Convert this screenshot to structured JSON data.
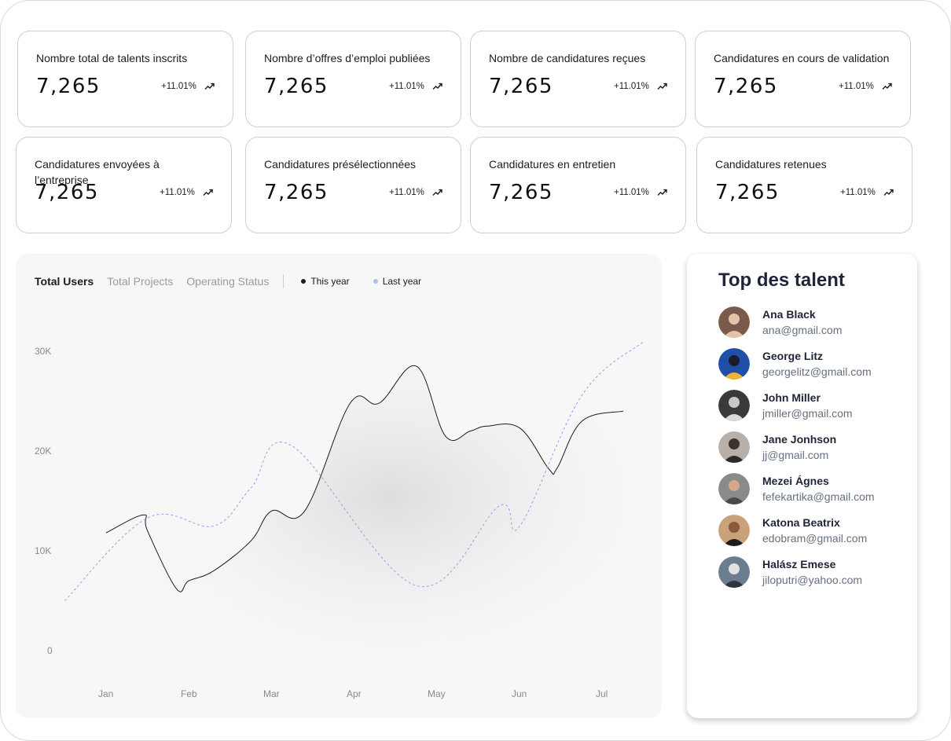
{
  "stats": [
    {
      "label": "Nombre total de talents inscrits",
      "value": "7,265",
      "change": "+11.01%"
    },
    {
      "label": "Nombre d’offres d’emploi publiées",
      "value": "7,265",
      "change": "+11.01%"
    },
    {
      "label": "Nombre de candidatures reçues",
      "value": "7,265",
      "change": "+11.01%"
    },
    {
      "label": "Candidatures en cours de validation",
      "value": "7,265",
      "change": "+11.01%"
    },
    {
      "label": "Candidatures envoyées à l’entreprise",
      "value": "7,265",
      "change": "+11.01%"
    },
    {
      "label": "Candidatures présélectionnées",
      "value": "7,265",
      "change": "+11.01%"
    },
    {
      "label": "Candidatures en entretien",
      "value": "7,265",
      "change": "+11.01%"
    },
    {
      "label": "Candidatures retenues",
      "value": "7,265",
      "change": "+11.01%"
    }
  ],
  "chart_tabs": [
    {
      "label": "Total Users",
      "active": true
    },
    {
      "label": "Total Projects",
      "active": false
    },
    {
      "label": "Operating Status",
      "active": false
    }
  ],
  "chart_data": {
    "type": "line",
    "categories": [
      "Jan",
      "Feb",
      "Mar",
      "Apr",
      "May",
      "Jun",
      "Jul"
    ],
    "y_ticks": [
      "0",
      "10K",
      "20K",
      "30K"
    ],
    "ylim": [
      0,
      30000
    ],
    "grid": false,
    "legend_position": "top",
    "series": [
      {
        "name": "This year",
        "color": "#1c1c1c",
        "style": "solid",
        "area_fill": true,
        "x": [
          0.0,
          0.45,
          0.5,
          0.85,
          1.0,
          1.3,
          1.75,
          2.0,
          2.4,
          2.95,
          3.3,
          3.75,
          4.1,
          4.4,
          4.6,
          5.0,
          5.35,
          5.45,
          5.75,
          6.25
        ],
        "y": [
          11800,
          13600,
          12000,
          6200,
          7000,
          8000,
          11000,
          14000,
          14000,
          24800,
          24800,
          28500,
          21500,
          22000,
          22500,
          22300,
          18200,
          18300,
          23000,
          24000
        ]
      },
      {
        "name": "Last year",
        "color": "#8fa3ec",
        "style": "dashed",
        "area_fill": false,
        "x": [
          -0.5,
          0.5,
          1.3,
          1.75,
          2.25,
          3.75,
          4.75,
          5.0,
          5.75,
          6.5
        ],
        "y": [
          5000,
          13300,
          12500,
          16300,
          20500,
          6500,
          14500,
          12500,
          25600,
          31000
        ]
      }
    ]
  },
  "top_talents": {
    "title": "Top des talent",
    "people": [
      {
        "name": "Ana Black",
        "email": "ana@gmail.com",
        "avatar_color": "#7a5a4a"
      },
      {
        "name": "George Litz",
        "email": "georgelitz@gmail.com",
        "avatar_color": "#1f4fa6"
      },
      {
        "name": "John Miller",
        "email": "jmiller@gmail.com",
        "avatar_color": "#3a3a3a"
      },
      {
        "name": "Jane Jonhson",
        "email": "jj@gmail.com",
        "avatar_color": "#b8b0a8"
      },
      {
        "name": "Mezei Ágnes",
        "email": "fefekartika@gmail.com",
        "avatar_color": "#8a8a8a"
      },
      {
        "name": "Katona Beatrix",
        "email": "edobram@gmail.com",
        "avatar_color": "#c9a27a"
      },
      {
        "name": "Halász Emese",
        "email": "jiloputri@yahoo.com",
        "avatar_color": "#6b7d8f"
      }
    ]
  }
}
